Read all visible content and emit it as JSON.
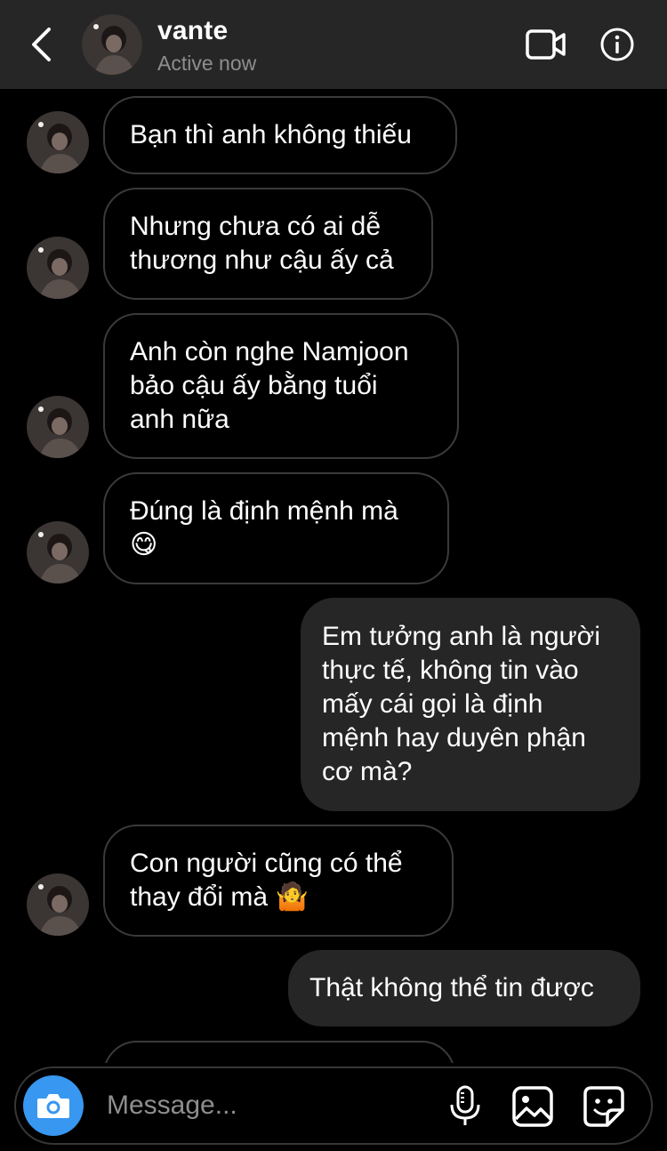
{
  "header": {
    "username": "vante",
    "status": "Active now"
  },
  "messages": [
    {
      "side": "in",
      "text": "Bạn thì anh không thiếu"
    },
    {
      "side": "in",
      "text": "Nhưng chưa có ai dễ\nthương như cậu ấy cả"
    },
    {
      "side": "in",
      "text": "Anh còn nghe Namjoon\nbảo cậu ấy bằng tuổi\nanh nữa"
    },
    {
      "side": "in",
      "text": "Đúng là định mệnh mà",
      "emoji": "😋"
    },
    {
      "side": "out",
      "text": "Em tưởng anh là người\nthực tế, không tin vào\nmấy cái gọi là định\nmệnh hay duyên phận\ncơ mà?"
    },
    {
      "side": "in",
      "text": "Con người cũng có thể\nthay đổi mà",
      "emoji": "🤷"
    },
    {
      "side": "out",
      "text": "Thật không thể tin được"
    }
  ],
  "composer": {
    "placeholder": "Message...",
    "icons": [
      "camera-icon",
      "microphone-icon",
      "gallery-icon",
      "sticker-icon"
    ]
  },
  "colors": {
    "header_bg": "#262626",
    "incoming_border": "#3a3a3a",
    "outgoing_bg": "#262626",
    "camera_blue": "#3897f0",
    "secondary_text": "#8e8e8e"
  }
}
